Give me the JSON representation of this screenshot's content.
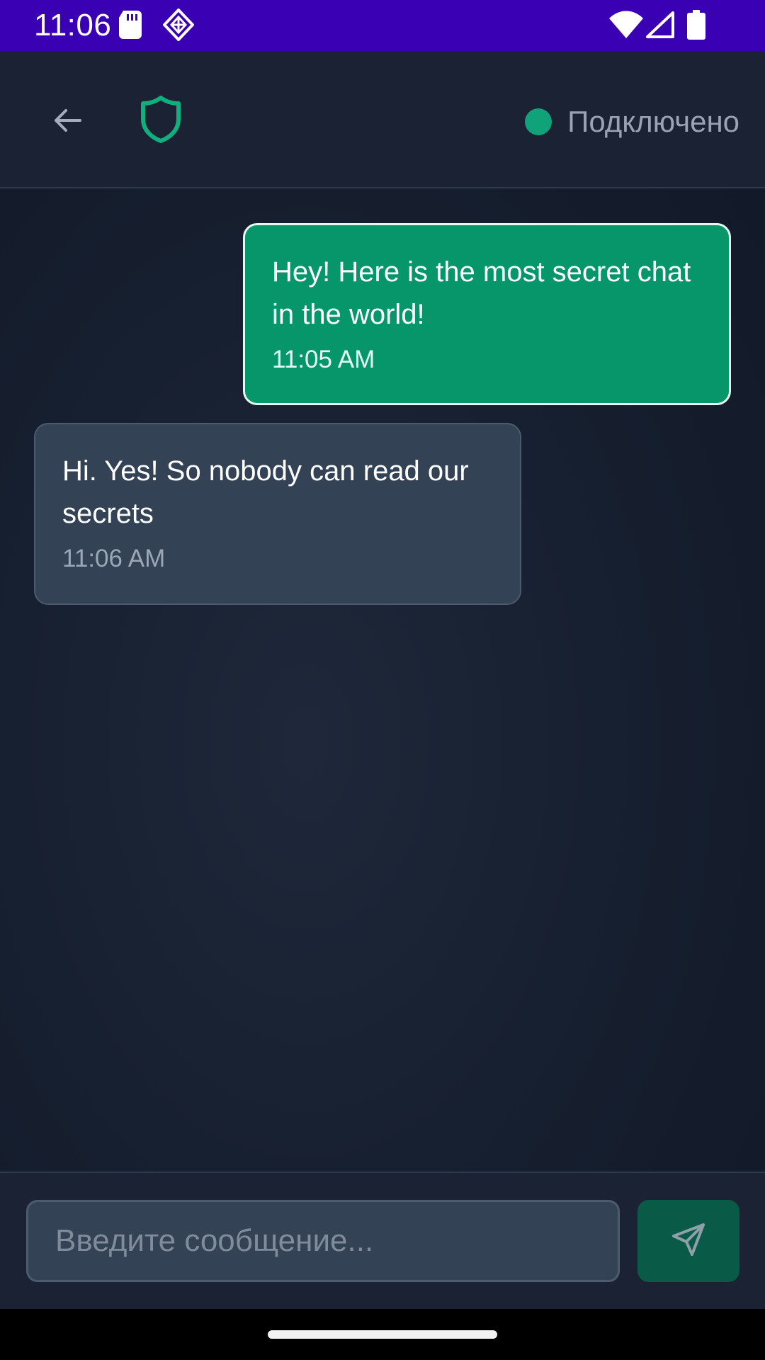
{
  "status_bar": {
    "time": "11:06",
    "icons": [
      "sd-card-icon",
      "app-notification-icon",
      "wifi-icon",
      "cell-signal-icon",
      "battery-icon"
    ],
    "background": "#3a00b4"
  },
  "header": {
    "back_icon": "back-arrow-icon",
    "logo_icon": "shield-icon",
    "connection_status": "Подключено",
    "status_color": "#10a37a"
  },
  "messages": [
    {
      "direction": "outgoing",
      "text": "Hey! Here is the most secret chat in the world!",
      "time": "11:05 AM"
    },
    {
      "direction": "incoming",
      "text": "Hi. Yes! So nobody can read our secrets",
      "time": "11:06 AM"
    }
  ],
  "composer": {
    "placeholder": "Введите сообщение...",
    "value": "",
    "send_icon": "send-icon"
  },
  "colors": {
    "accent": "#07966a",
    "incoming_bubble": "#344256",
    "background": "#172030"
  }
}
